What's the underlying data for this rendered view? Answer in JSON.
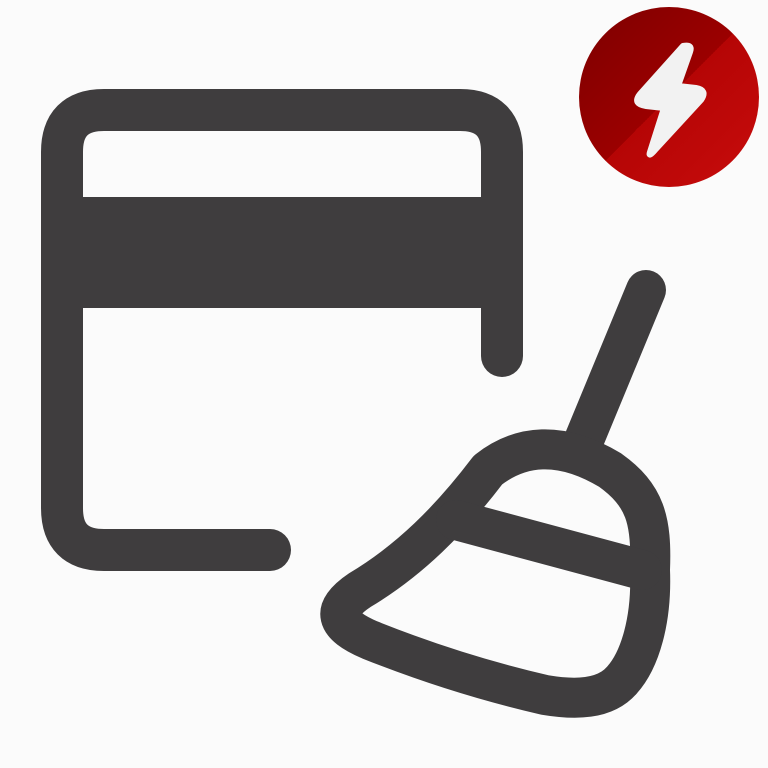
{
  "icon": {
    "primary": "credit-card-icon",
    "secondary": "broom-icon",
    "overlay_badge": "lightning-bolt-icon"
  },
  "colors": {
    "background": "#fbfbfb",
    "icon_stroke": "#3f3d3e",
    "badge_dark": "#8e0000",
    "badge_light": "#c00a0a",
    "bolt_fill": "#f2f2f2"
  }
}
